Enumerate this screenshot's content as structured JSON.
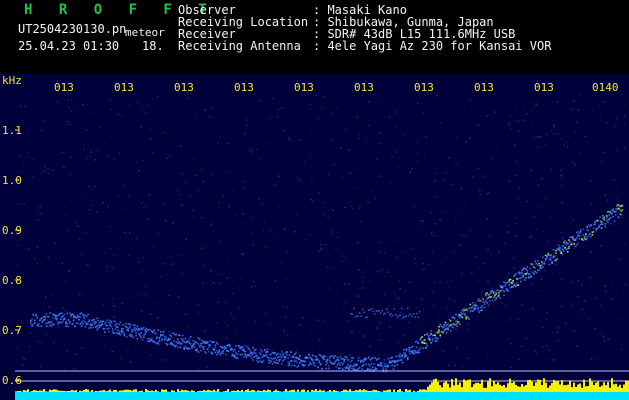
{
  "header": {
    "logo": "H R O F F T",
    "filename": "UT2504230130.pn",
    "tag": "meteor",
    "timestamp": "25.04.23 01:30",
    "value": "18.",
    "info": [
      {
        "label": "Observer",
        "sep": ": ",
        "value": "Masaki Kano"
      },
      {
        "label": "Receiving Location",
        "sep": ": ",
        "value": "Shibukawa, Gunma, Japan"
      },
      {
        "label": "Receiver",
        "sep": ": ",
        "value": "SDR# 43dB L15 111.6MHz USB"
      },
      {
        "label": "Receiving Antenna",
        "sep": ": ",
        "value": "4ele Yagi Az 230 for Kansai VOR"
      }
    ]
  },
  "chart_data": {
    "type": "heatmap",
    "ylabel": "kHz",
    "y_ticks": [
      "1.1",
      "1.0",
      "0.9",
      "0.8",
      "0.7",
      "0.6"
    ],
    "x_ticks": [
      "013",
      "013",
      "013",
      "013",
      "013",
      "013",
      "013",
      "013",
      "013",
      "0140"
    ],
    "colors": {
      "background": "#00003a",
      "trace": "#3f7bff",
      "hot": "#b8ff2a",
      "label": "#f2e23a",
      "band": "#00e0ff"
    }
  }
}
